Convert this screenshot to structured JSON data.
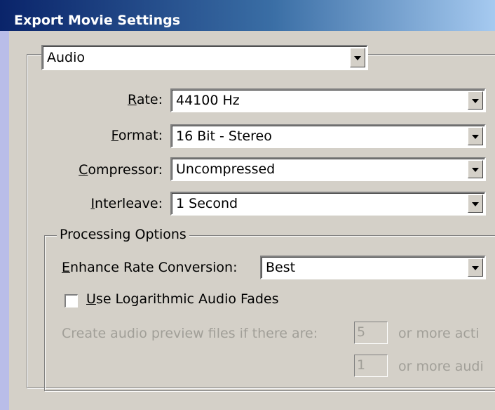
{
  "window": {
    "title": "Export Movie Settings"
  },
  "section_select": {
    "value": "Audio"
  },
  "audio": {
    "rate": {
      "label_pre": "",
      "label_u": "R",
      "label_post": "ate:",
      "value": "44100 Hz"
    },
    "format": {
      "label_pre": "",
      "label_u": "F",
      "label_post": "ormat:",
      "value": "16 Bit - Stereo"
    },
    "compressor": {
      "label_pre": "",
      "label_u": "C",
      "label_post": "ompressor:",
      "value": "Uncompressed"
    },
    "interleave": {
      "label_pre": "",
      "label_u": "I",
      "label_post": "nterleave:",
      "value": "1 Second"
    }
  },
  "processing": {
    "group_title": "Processing Options",
    "enhance": {
      "label_pre": "",
      "label_u": "E",
      "label_post": "nhance Rate Conversion:",
      "value": "Best"
    },
    "log_fades": {
      "label_pre": "",
      "label_u": "U",
      "label_post": "se Logarithmic Audio Fades",
      "checked": false
    },
    "preview": {
      "label": "Create audio preview files if there are:",
      "tracks_value": "5",
      "tracks_suffix": "or more acti",
      "audio_value": "1",
      "audio_suffix": "or more audi"
    }
  }
}
